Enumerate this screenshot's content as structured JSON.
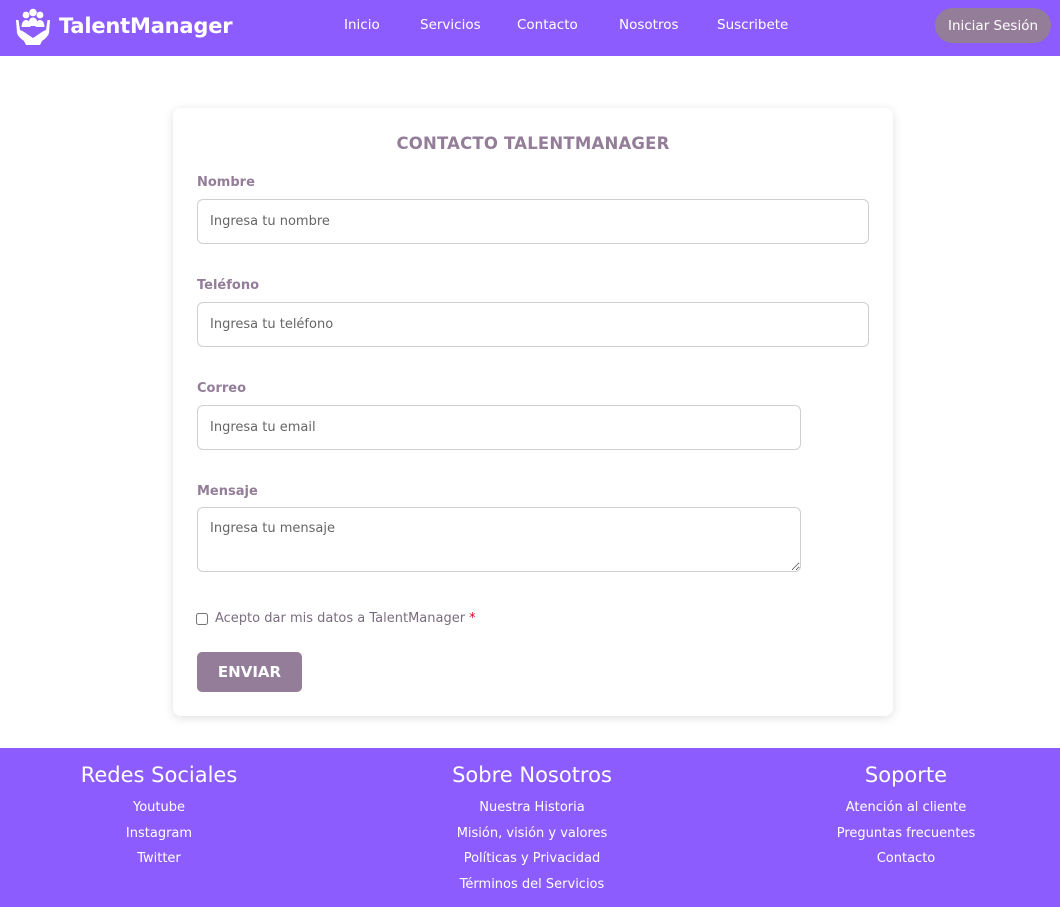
{
  "header": {
    "brand": "TalentManager",
    "nav": [
      "Inicio",
      "Servicios",
      "Contacto",
      "Nosotros",
      "Suscribete"
    ],
    "login_label": "Iniciar Sesión",
    "brand_color": "#8c5cff",
    "button_color": "#937d98"
  },
  "form": {
    "title": "CONTACTO TALENTMANAGER",
    "fields": {
      "name": {
        "label": "Nombre",
        "placeholder": "Ingresa tu nombre"
      },
      "phone": {
        "label": "Teléfono",
        "placeholder": "Ingresa tu teléfono"
      },
      "email": {
        "label": "Correo",
        "placeholder": "Ingresa tu email"
      },
      "message": {
        "label": "Mensaje",
        "placeholder": "Ingresa tu mensaje"
      }
    },
    "consent": {
      "text": "Acepto dar mis datos a TalentManager",
      "required_mark": "*"
    },
    "submit_label": "ENVIAR"
  },
  "footer": {
    "columns": [
      {
        "title": "Redes Sociales",
        "links": [
          "Youtube",
          "Instagram",
          "Twitter"
        ]
      },
      {
        "title": "Sobre Nosotros",
        "links": [
          "Nuestra Historia",
          "Misión, visión y valores",
          "Políticas y Privacidad",
          "Términos del Servicios"
        ]
      },
      {
        "title": "Soporte",
        "links": [
          "Atención al cliente",
          "Preguntas frecuentes",
          "Contacto"
        ]
      }
    ]
  }
}
